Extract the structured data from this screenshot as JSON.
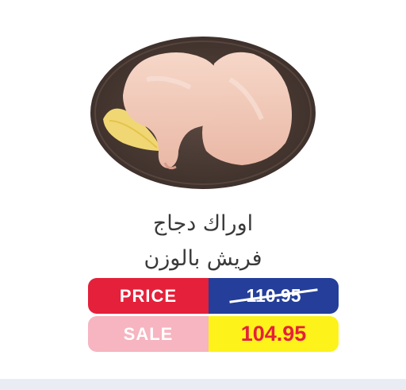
{
  "product": {
    "image_label": "chicken-legs-image",
    "title_line1": "اوراك دجاج",
    "title_line2": "فريش بالوزن"
  },
  "pricing": {
    "price_label": "PRICE",
    "old_price": "110.95",
    "sale_label": "SALE",
    "sale_price": "104.95"
  },
  "colors": {
    "price_red": "#e5203a",
    "old_price_blue": "#243e9a",
    "sale_pink": "#f6b5c0",
    "sale_yellow": "#fdf21a",
    "footer_strip": "#e9edf3"
  }
}
